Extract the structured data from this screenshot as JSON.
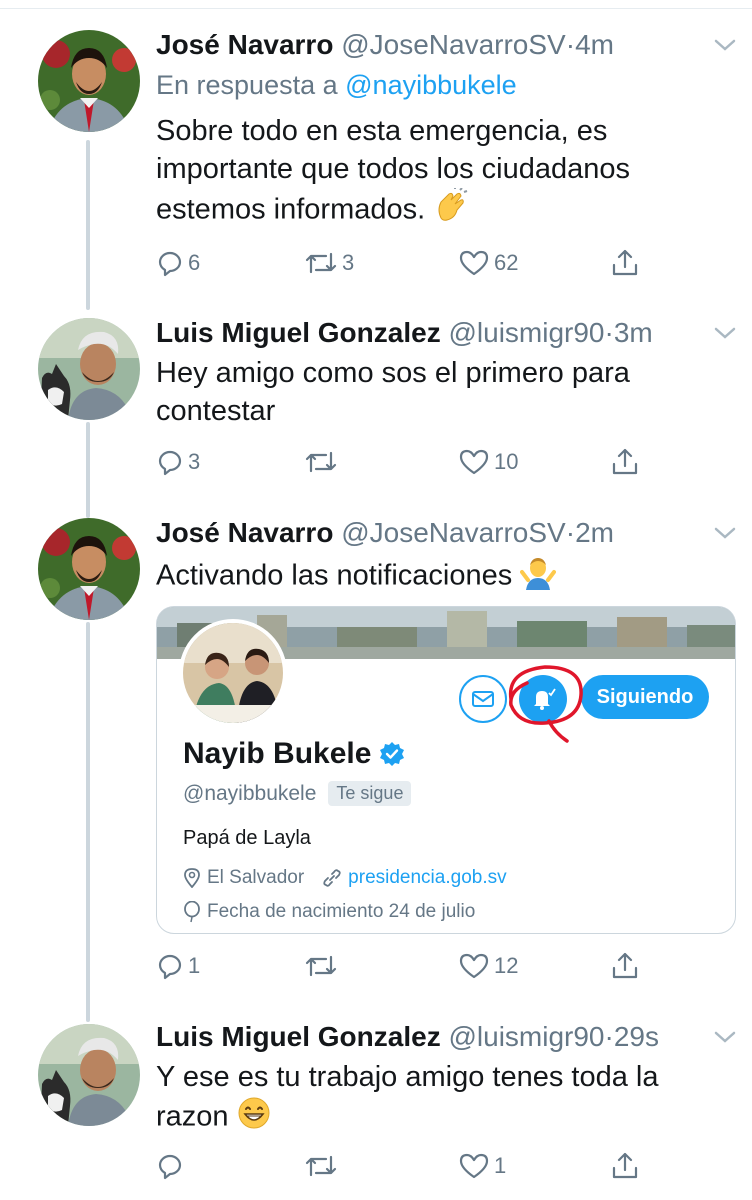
{
  "tweets": [
    {
      "name": "José Navarro",
      "handle": "@JoseNavarroSV",
      "time": "4m",
      "reply_prefix": "En respuesta a",
      "reply_mention": "@nayibbukele",
      "text": "Sobre todo en esta emergencia, es importante que todos los ciudadanos estemos informados.",
      "emoji": "clapping-hands-emoji",
      "counts": {
        "reply": "6",
        "retweet": "3",
        "like": "62"
      }
    },
    {
      "name": "Luis Miguel Gonzalez",
      "handle": "@luismigr90",
      "time": "3m",
      "text": "Hey amigo como sos el primero para contestar",
      "counts": {
        "reply": "3",
        "retweet": "",
        "like": "10"
      }
    },
    {
      "name": "José Navarro",
      "handle": "@JoseNavarroSV",
      "time": "2m",
      "text": "Activando las notificaciones",
      "emoji": "person-shrugging-emoji",
      "counts": {
        "reply": "1",
        "retweet": "",
        "like": "12"
      }
    },
    {
      "name": "Luis Miguel Gonzalez",
      "handle": "@luismigr90",
      "time": "29s",
      "text": "Y ese es tu trabajo amigo tenes toda la razon",
      "emoji": "grinning-face-emoji",
      "counts": {
        "reply": "",
        "retweet": "",
        "like": "1"
      }
    }
  ],
  "separator": "·",
  "profile_card": {
    "name": "Nayib Bukele",
    "handle": "@nayibbukele",
    "follows_you": "Te sigue",
    "bio": "Papá de Layla",
    "location": "El Salvador",
    "website": "presidencia.gob.sv",
    "birthday": "Fecha de nacimiento 24 de julio",
    "follow_button": "Siguiendo"
  },
  "colors": {
    "accent": "#1da1f2",
    "text_secondary": "#657786",
    "annotation_red": "#e0162b"
  }
}
